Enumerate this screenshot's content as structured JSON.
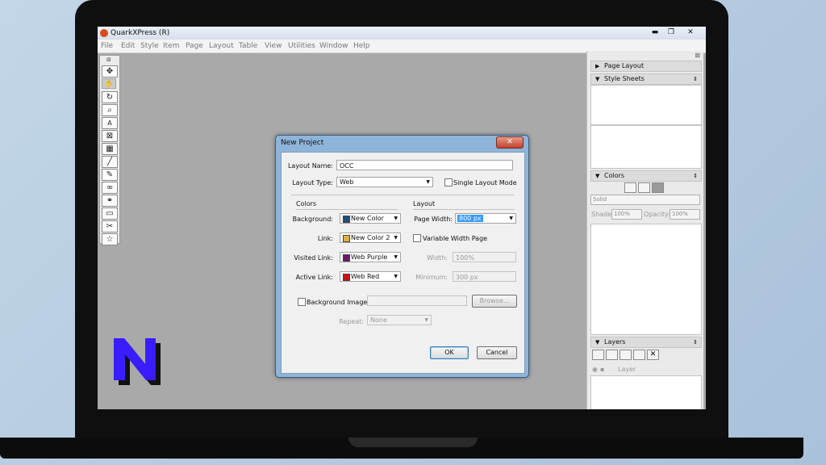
{
  "window": {
    "title": "QuarkXPress (R)",
    "controls": [
      "▬",
      "❐",
      "✕"
    ]
  },
  "menu": [
    "File",
    "Edit",
    "Style",
    "Item",
    "Page",
    "Layout",
    "Table",
    "View",
    "Utilities",
    "Window",
    "Help"
  ],
  "tools": [
    "move-tool",
    "hand-tool",
    "rotate-tool",
    "zoom-tool",
    "text-box-tool",
    "picture-box-tool",
    "table-tool",
    "line-tool",
    "bezier-tool",
    "link-tool",
    "unlink-tool",
    "layers-tool",
    "scissors-tool",
    "star-tool"
  ],
  "palettes": {
    "page_layout": "Page Layout",
    "style_sheets": "Style Sheets",
    "colors": "Colors",
    "colors_fill": "Solid",
    "shade_label": "Shade:",
    "shade_value": "100%",
    "opacity_label": "Opacity:",
    "opacity_value": "100%",
    "layers": "Layers",
    "layer_col": "Layer"
  },
  "dialog": {
    "title": "New Project",
    "layout_name_label": "Layout Name:",
    "layout_name_value": "OCC",
    "layout_type_label": "Layout Type:",
    "layout_type_value": "Web",
    "single_layout_label": "Single Layout Mode",
    "colors_section": "Colors",
    "layout_section": "Layout",
    "background_label": "Background:",
    "background_value": "New Color",
    "background_color": "#1f4e79",
    "link_label": "Link:",
    "link_value": "New Color 2",
    "link_color": "#e0b040",
    "visited_label": "Visited Link:",
    "visited_value": "Web Purple",
    "visited_color": "#6a1b6a",
    "active_label": "Active Link:",
    "active_value": "Web Red",
    "active_color": "#cc1111",
    "page_width_label": "Page Width:",
    "page_width_value": "800 px",
    "variable_width_label": "Variable Width Page",
    "width_label": "Width:",
    "width_value": "100%",
    "minimum_label": "Minimum:",
    "minimum_value": "300 px",
    "bg_image_label": "Background Image:",
    "browse_label": "Browse...",
    "repeat_label": "Repeat:",
    "repeat_value": "None",
    "ok_label": "OK",
    "cancel_label": "Cancel"
  }
}
